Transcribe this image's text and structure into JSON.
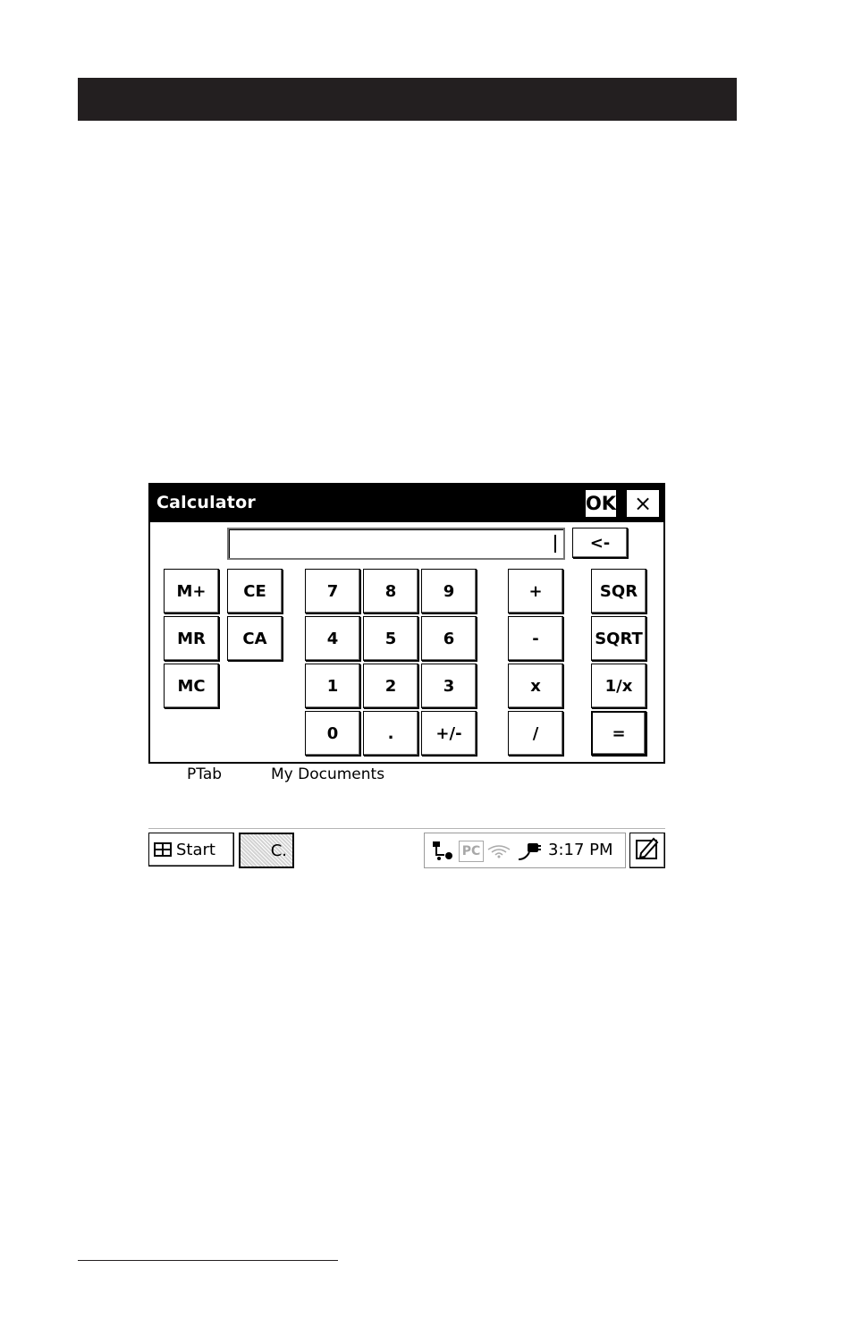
{
  "window": {
    "title": "Calculator",
    "ok_label": "OK",
    "close_label": "×"
  },
  "display": {
    "value": "",
    "backspace_label": "<-"
  },
  "buttons": {
    "m_plus": "M+",
    "ce": "CE",
    "mr": "MR",
    "ca": "CA",
    "mc": "MC",
    "d7": "7",
    "d8": "8",
    "d9": "9",
    "d4": "4",
    "d5": "5",
    "d6": "6",
    "d1": "1",
    "d2": "2",
    "d3": "3",
    "d0": "0",
    "dot": ".",
    "plus_minus": "+/-",
    "add": "+",
    "subtract": "-",
    "multiply": "x",
    "divide": "/",
    "sqr": "SQR",
    "sqrt": "SQRT",
    "reciprocal": "1/x",
    "equals": "="
  },
  "desktop_labels": [
    "PTab",
    "My Documents"
  ],
  "taskbar": {
    "start_label": "Start",
    "task_label": "C.",
    "tray_pc_label": "PC",
    "clock": "3:17 PM",
    "icons": [
      "start-windows-icon",
      "network-icon",
      "pc-connection-icon",
      "wireless-icon",
      "power-plug-icon",
      "input-panel-icon"
    ]
  }
}
